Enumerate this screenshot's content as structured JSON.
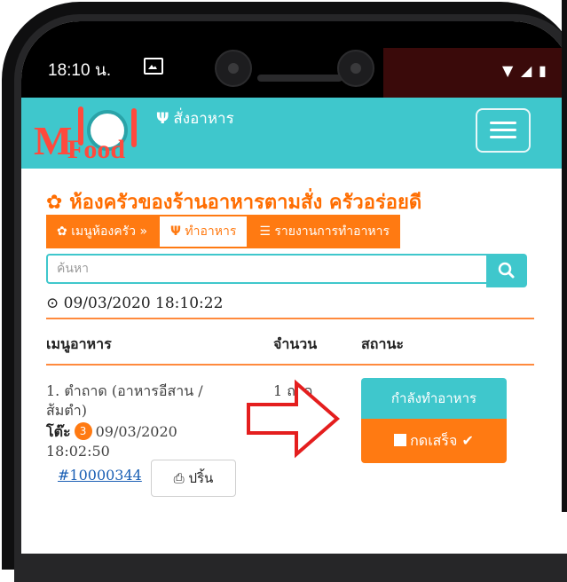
{
  "status_bar": {
    "time": "18:10 น."
  },
  "navbar": {
    "logo_text_m": "M",
    "logo_text_food": "Food",
    "order_link": "สั่งอาหาร"
  },
  "page": {
    "title": "ห้องครัวของร้านอาหารตามสั่ง ครัวอร่อยดี",
    "tabs": [
      {
        "label": "เมนูห้องครัว »"
      },
      {
        "label": "ทำอาหาร"
      },
      {
        "label": "รายงานการทำอาหาร"
      }
    ],
    "search": {
      "placeholder": "ค้นหา",
      "value": ""
    },
    "timestamp": "09/03/2020 18:10:22"
  },
  "table": {
    "headers": [
      "เมนูอาหาร",
      "จำนวน",
      "สถานะ"
    ],
    "rows": [
      {
        "item_line1": "1. ตำถาด (อาหารอีสาน /",
        "item_line2": "ส้มตำ)",
        "table_label": "โต๊ะ",
        "table_number": "3",
        "order_date": "09/03/2020",
        "order_time": "18:02:50",
        "order_id": "#10000344",
        "print_label": "ปริ้น",
        "quantity": "1 ถาด",
        "status_label": "กำลังทำอาหาร",
        "done_label": "กดเสร็จ"
      }
    ]
  },
  "colors": {
    "accent_teal": "#3fc7cc",
    "accent_orange": "#ff7a12",
    "brand_red": "#ff4a3d"
  }
}
